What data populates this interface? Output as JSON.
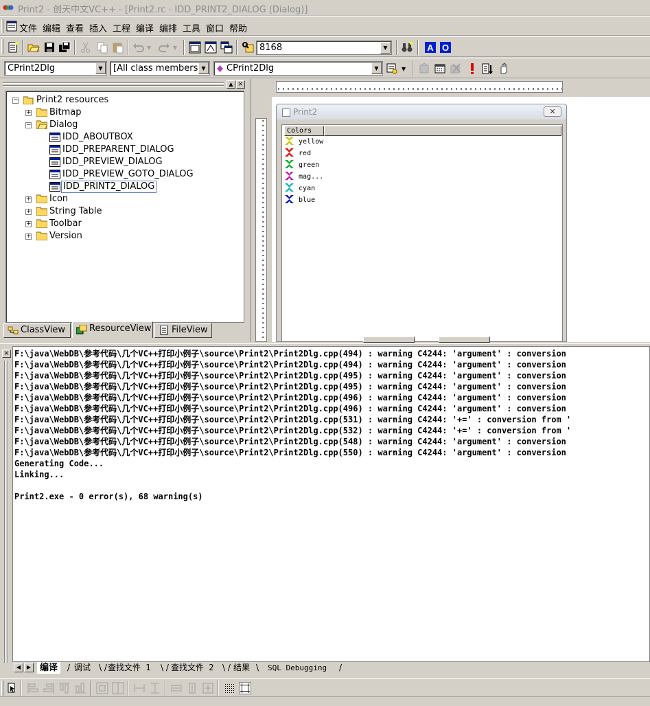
{
  "window": {
    "title": "Print2 - 创天中文VC++ - [Print2.rc - IDD_PRINT2_DIALOG (Dialog)]"
  },
  "menu": [
    "文件",
    "编辑",
    "查看",
    "插入",
    "工程",
    "编译",
    "编排",
    "工具",
    "窗口",
    "帮助"
  ],
  "toolbar": {
    "find_value": "8168"
  },
  "wizardbar": {
    "class_combo": "CPrint2Dlg",
    "filter_combo": "[All class members]",
    "member_combo": "CPrint2Dlg"
  },
  "workspace": {
    "root": "Print2 resources",
    "folders": [
      "Bitmap",
      "Dialog",
      "Icon",
      "String Table",
      "Toolbar",
      "Version"
    ],
    "dialogs": [
      "IDD_ABOUTBOX",
      "IDD_PREPARENT_DIALOG",
      "IDD_PREVIEW_DIALOG",
      "IDD_PREVIEW_GOTO_DIALOG",
      "IDD_PRINT2_DIALOG"
    ],
    "selected": "IDD_PRINT2_DIALOG",
    "tabs": [
      "ClassView",
      "ResourceView",
      "FileView"
    ],
    "active_tab": "ResourceView"
  },
  "dialog_preview": {
    "title": "Print2",
    "list_header": "Colors",
    "items": [
      {
        "label": "yellow",
        "color": "#c8c800"
      },
      {
        "label": "red",
        "color": "#e01010"
      },
      {
        "label": "green",
        "color": "#10b030"
      },
      {
        "label": "mag...",
        "color": "#c020c0"
      },
      {
        "label": "cyan",
        "color": "#10b8b8"
      },
      {
        "label": "blue",
        "color": "#1020c0"
      }
    ]
  },
  "output": {
    "lines": [
      "F:\\java\\WebDB\\参考代码\\几个VC++打印小例子\\source\\Print2\\Print2Dlg.cpp(494) : warning C4244: 'argument' : conversion",
      "F:\\java\\WebDB\\参考代码\\几个VC++打印小例子\\source\\Print2\\Print2Dlg.cpp(494) : warning C4244: 'argument' : conversion",
      "F:\\java\\WebDB\\参考代码\\几个VC++打印小例子\\source\\Print2\\Print2Dlg.cpp(495) : warning C4244: 'argument' : conversion",
      "F:\\java\\WebDB\\参考代码\\几个VC++打印小例子\\source\\Print2\\Print2Dlg.cpp(495) : warning C4244: 'argument' : conversion",
      "F:\\java\\WebDB\\参考代码\\几个VC++打印小例子\\source\\Print2\\Print2Dlg.cpp(496) : warning C4244: 'argument' : conversion",
      "F:\\java\\WebDB\\参考代码\\几个VC++打印小例子\\source\\Print2\\Print2Dlg.cpp(496) : warning C4244: 'argument' : conversion",
      "F:\\java\\WebDB\\参考代码\\几个VC++打印小例子\\source\\Print2\\Print2Dlg.cpp(531) : warning C4244: '+=' : conversion from '",
      "F:\\java\\WebDB\\参考代码\\几个VC++打印小例子\\source\\Print2\\Print2Dlg.cpp(532) : warning C4244: '+=' : conversion from '",
      "F:\\java\\WebDB\\参考代码\\几个VC++打印小例子\\source\\Print2\\Print2Dlg.cpp(548) : warning C4244: 'argument' : conversion",
      "F:\\java\\WebDB\\参考代码\\几个VC++打印小例子\\source\\Print2\\Print2Dlg.cpp(550) : warning C4244: 'argument' : conversion",
      "Generating Code...",
      "Linking...",
      "",
      "Print2.exe - 0 error(s), 68 warning(s)"
    ],
    "tabs": [
      "编译",
      "调试",
      "查找文件 1",
      "查找文件 2",
      "结果",
      "SQL Debugging"
    ],
    "active_tab": "编译"
  }
}
